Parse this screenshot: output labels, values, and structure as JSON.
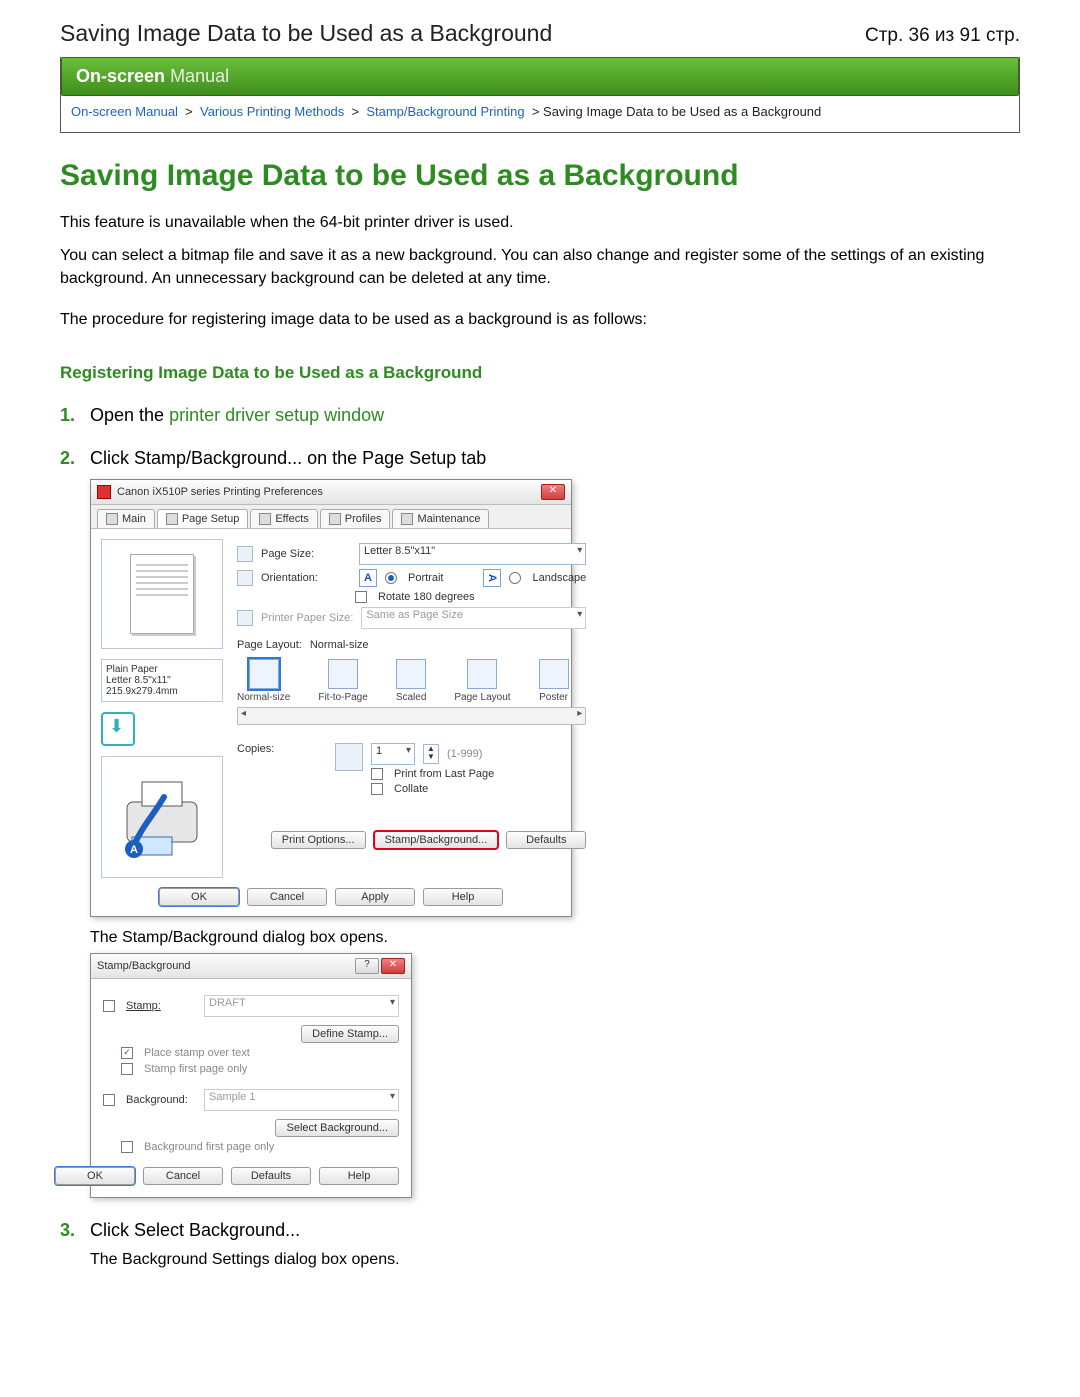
{
  "header": {
    "title": "Saving Image Data to be Used as a Background",
    "page_indicator": "Стр. 36 из 91 стр."
  },
  "manual_bar": {
    "bold": "On-screen",
    "thin": "Manual"
  },
  "breadcrumbs": {
    "a": "On-screen Manual",
    "b": "Various Printing Methods",
    "c": "Stamp/Background Printing",
    "tail": "Saving Image Data to be Used as a Background"
  },
  "h1": "Saving Image Data to be Used as a Background",
  "para1": "This feature is unavailable when the 64-bit printer driver is used.",
  "para2": "You can select a bitmap file and save it as a new background. You can also change and register some of the settings of an existing background. An unnecessary background can be deleted at any time.",
  "para3": "The procedure for registering image data to be used as a background is as follows:",
  "section": "Registering Image Data to be Used as a Background",
  "step1": {
    "num": "1.",
    "pre": "Open the ",
    "link": "printer driver setup window"
  },
  "step2": {
    "num": "2.",
    "text": "Click Stamp/Background... on the Page Setup tab",
    "after": "The Stamp/Background dialog box opens."
  },
  "step3": {
    "num": "3.",
    "text": "Click Select Background...",
    "after": "The Background Settings dialog box opens."
  },
  "dlg1": {
    "title": "Canon iX510P series Printing Preferences",
    "tabs": [
      "Main",
      "Page Setup",
      "Effects",
      "Profiles",
      "Maintenance"
    ],
    "page_size_lbl": "Page Size:",
    "page_size_val": "Letter 8.5\"x11\"",
    "orientation_lbl": "Orientation:",
    "portrait": "Portrait",
    "landscape": "Landscape",
    "rotate": "Rotate 180 degrees",
    "printer_size_lbl": "Printer Paper Size:",
    "printer_size_val": "Same as Page Size",
    "layout_lbl": "Page Layout:",
    "layout_val": "Normal-size",
    "layouts": [
      "Normal-size",
      "Fit-to-Page",
      "Scaled",
      "Page Layout",
      "Poster"
    ],
    "copies_lbl": "Copies:",
    "copies_val": "1",
    "copies_range": "(1-999)",
    "print_last": "Print from Last Page",
    "collate": "Collate",
    "media1": "Plain Paper",
    "media2": "Letter 8.5\"x11\" 215.9x279.4mm",
    "print_options": "Print Options...",
    "stamp_bg": "Stamp/Background...",
    "defaults": "Defaults",
    "ok": "OK",
    "cancel": "Cancel",
    "apply": "Apply",
    "help": "Help"
  },
  "dlg2": {
    "title": "Stamp/Background",
    "stamp_chk": "Stamp:",
    "stamp_val": "DRAFT",
    "define_stamp": "Define Stamp...",
    "place_over": "Place stamp over text",
    "stamp_first": "Stamp first page only",
    "bg_chk": "Background:",
    "bg_val": "Sample 1",
    "select_bg": "Select Background...",
    "bg_first": "Background first page only",
    "ok": "OK",
    "cancel": "Cancel",
    "defaults": "Defaults",
    "help": "Help"
  }
}
